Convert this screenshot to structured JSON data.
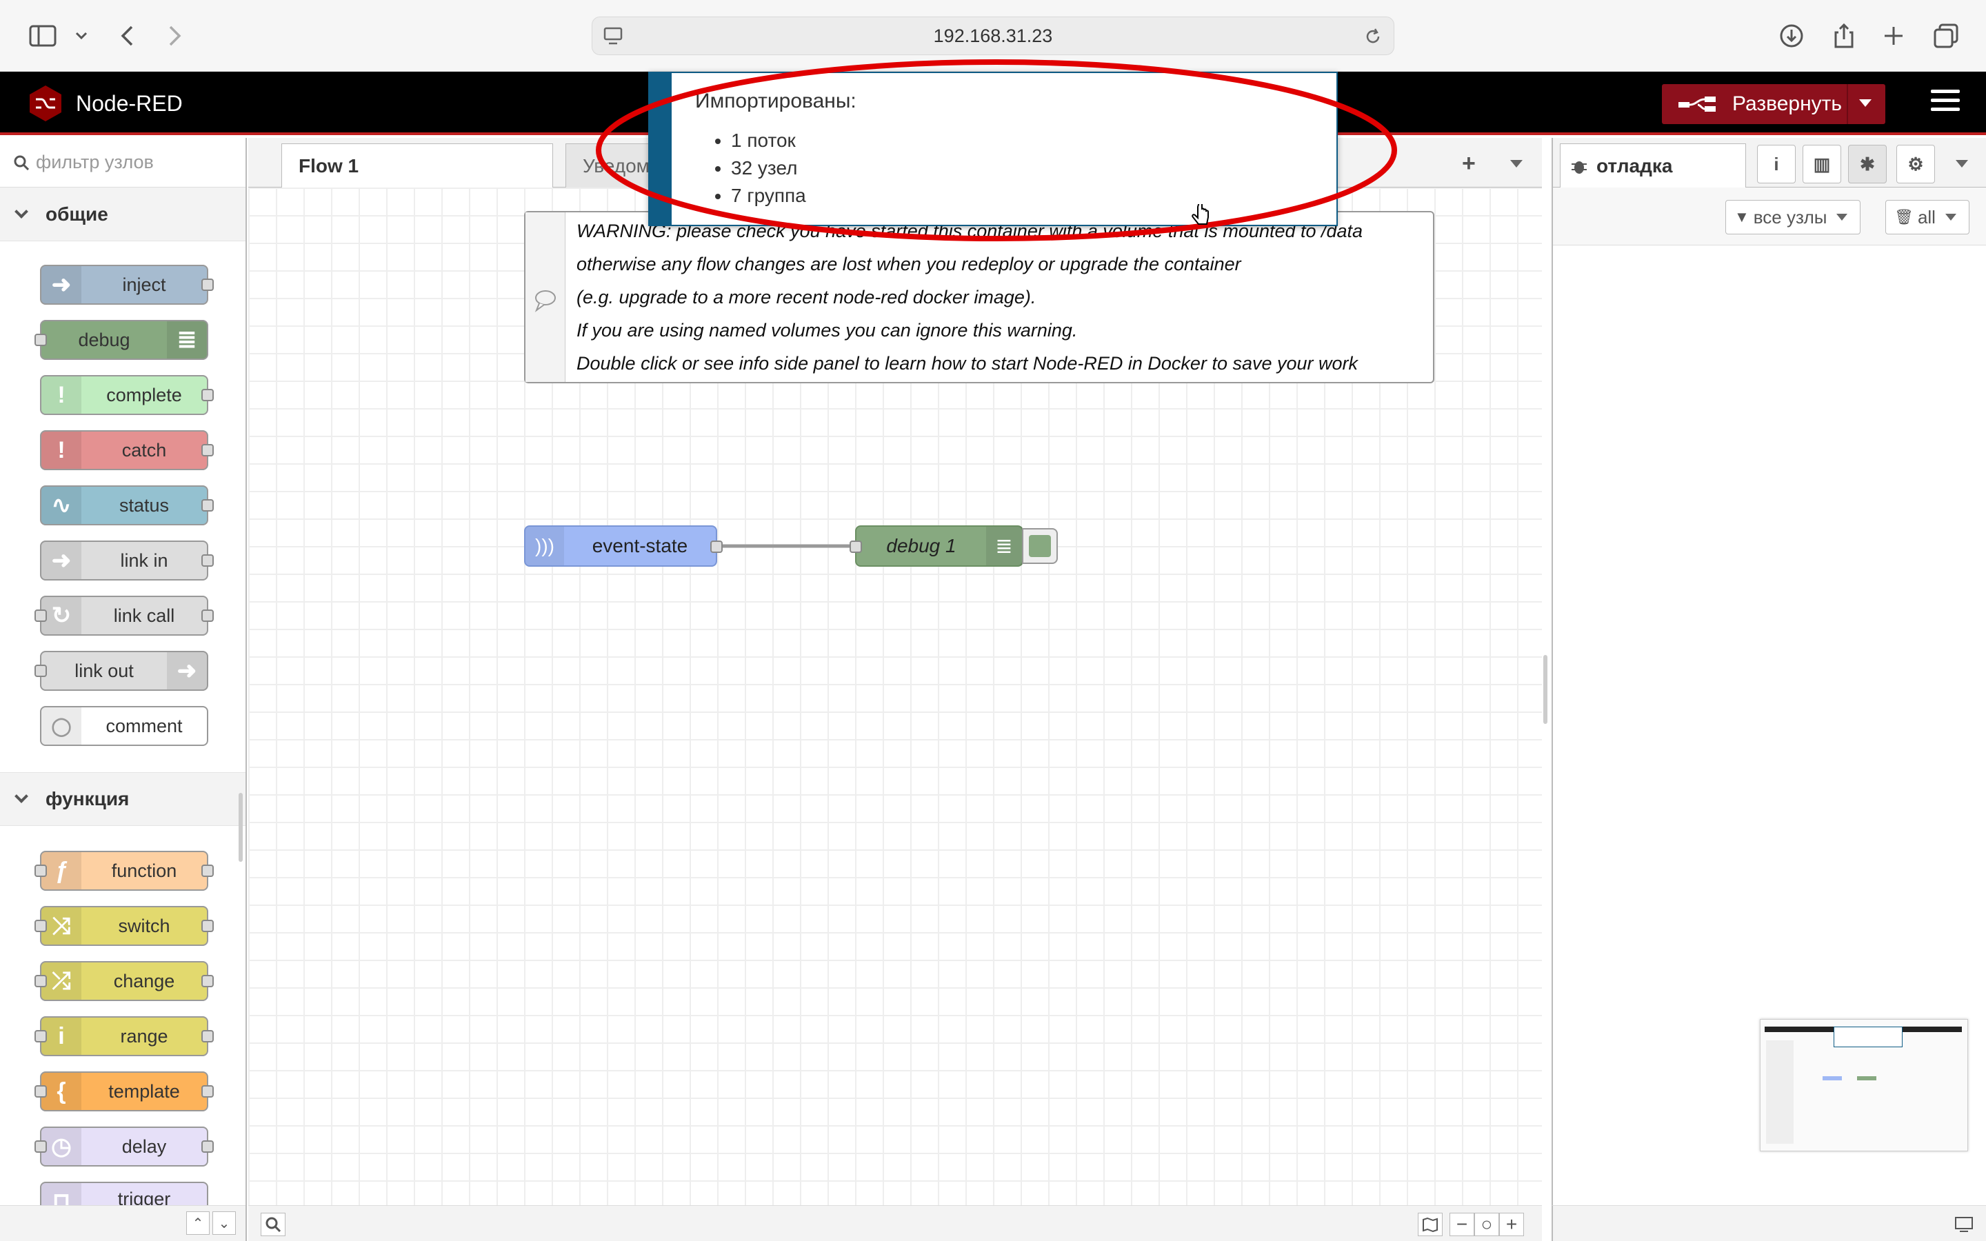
{
  "browser": {
    "url": "192.168.31.23"
  },
  "app": {
    "title": "Node-RED"
  },
  "header": {
    "deploy_label": "Развернуть"
  },
  "palette": {
    "search_placeholder": "фильтр узлов",
    "categories": [
      {
        "name": "общие",
        "nodes": [
          "inject",
          "debug",
          "complete",
          "catch",
          "status",
          "link in",
          "link call",
          "link out",
          "comment"
        ]
      },
      {
        "name": "функция",
        "nodes": [
          "function",
          "switch",
          "change",
          "range",
          "template",
          "delay",
          "trigger"
        ]
      }
    ]
  },
  "tabs": [
    {
      "label": "Flow 1"
    },
    {
      "label": "Уведом"
    }
  ],
  "comment": {
    "lines": [
      "WARNING: please check you have started this container with a volume that is mounted to /data",
      "otherwise any flow changes are lost when you redeploy or upgrade the container",
      "(e.g. upgrade to a more recent node-red docker image).",
      "If you are using named volumes you can ignore this warning.",
      "Double click or see info side panel to learn how to start Node-RED in Docker to save your work"
    ]
  },
  "flow_nodes": {
    "event_state": "event-state",
    "debug1": "debug 1"
  },
  "sidebar": {
    "tab_label": "отладка",
    "filter_label": "все узлы",
    "clear_label": "all"
  },
  "notification": {
    "title": "Импортированы:",
    "items": [
      "1 поток",
      "32 узел",
      "7 группа"
    ]
  },
  "colors": {
    "header_bg": "#000000",
    "header_border": "#c02020",
    "deploy": "#8c101c",
    "notification_accent": "#0f5c85",
    "inject": "#a6bbcf",
    "debug": "#87a980",
    "complete": "#c0edc0",
    "catch": "#e49191",
    "status": "#94c1d0",
    "link": "#dddddd",
    "function": "#fdd0a2",
    "switch": "#e2d96e",
    "template": "#fdb35a",
    "delay": "#e6e0f8",
    "event_state": "#9fb8f5",
    "highlight_oval": "#e00000"
  }
}
